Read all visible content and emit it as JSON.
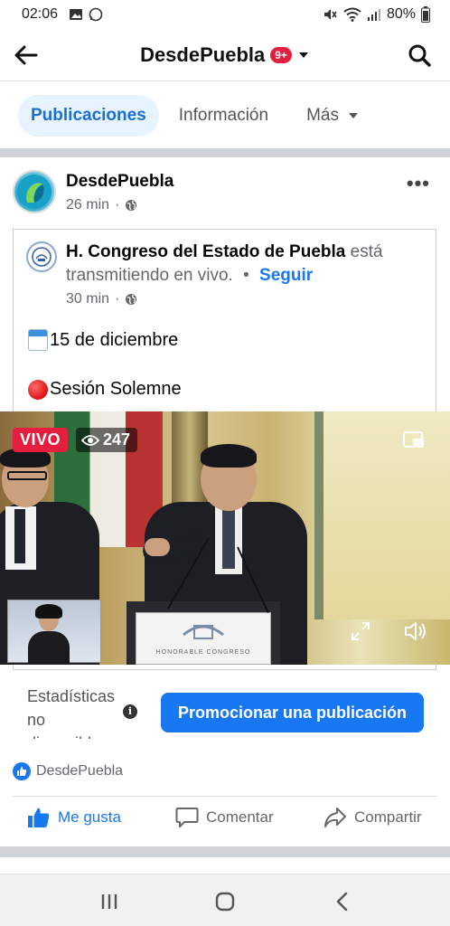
{
  "status_bar": {
    "time": "02:06",
    "battery": "80%"
  },
  "header": {
    "title": "DesdePuebla",
    "badge": "9+"
  },
  "tabs": [
    {
      "label": "Publicaciones"
    },
    {
      "label": "Información"
    },
    {
      "label": "Más"
    }
  ],
  "post": {
    "author": "DesdePuebla",
    "time": "26 min",
    "shared": {
      "org": "H. Congreso del Estado de Puebla",
      "status": "está transmitiendo en vivo.",
      "separator": "•",
      "follow": "Seguir",
      "time": "30 min",
      "line1": "15 de diciembre",
      "line2": "Sesión Solemne"
    },
    "video": {
      "live_label": "VIVO",
      "viewers": "247",
      "podium_text": "HONORABLE CONGRESO"
    },
    "stats_text": "Estadísticas no disponibles",
    "promote_label": "Promocionar una publicación",
    "reactions_name": "DesdePuebla",
    "actions": {
      "like": "Me gusta",
      "comment": "Comentar",
      "share": "Compartir"
    }
  },
  "colors": {
    "accent": "#1877f2",
    "live": "#e41e3f"
  }
}
